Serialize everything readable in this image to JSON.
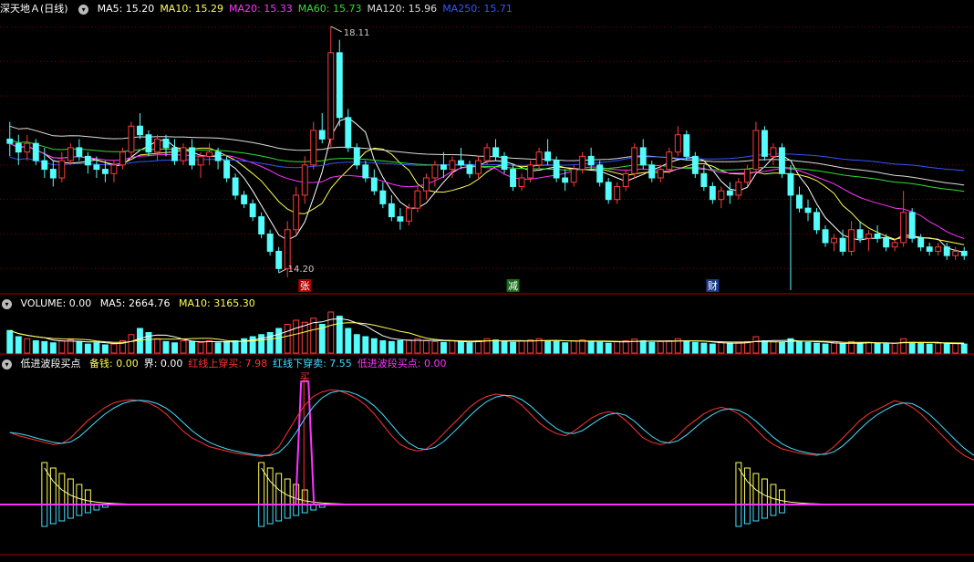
{
  "price_panel": {
    "title": "深天地Ａ(日线)",
    "indicators": [
      {
        "label": "MA5: 15.20",
        "color": "#ffffff"
      },
      {
        "label": "MA10: 15.29",
        "color": "#ffff55"
      },
      {
        "label": "MA20: 15.33",
        "color": "#ff33ff"
      },
      {
        "label": "MA60: 15.73",
        "color": "#33dd33"
      },
      {
        "label": "MA120: 15.96",
        "color": "#dddddd"
      },
      {
        "label": "MA250: 15.71",
        "color": "#3355ff"
      }
    ],
    "high_label": "18.11",
    "low_label": "14.20",
    "event_marks": [
      "张",
      "减",
      "财"
    ]
  },
  "volume_panel": {
    "title": "VOLUME: 0.00",
    "ma5": "MA5: 2664.76",
    "ma10": "MA10: 3165.30"
  },
  "indicator_panel": {
    "title": "低进波段买点",
    "fields": [
      {
        "label": "备钱: 0.00",
        "color": "#ffff55"
      },
      {
        "label": "界: 0.00",
        "color": "#ffffff"
      },
      {
        "label": "红线上穿买: 7.98",
        "color": "#ff3333"
      },
      {
        "label": "红线下穿卖: 7.55",
        "color": "#44ddff"
      },
      {
        "label": "低进波段买点: 0.00",
        "color": "#ff33ff"
      }
    ],
    "buy_signal_label": "买"
  },
  "colors": {
    "up": "#ff3c3c",
    "down": "#54fcfc",
    "grid": "#7a0000",
    "ma250": "#2b3bff"
  },
  "chart_data": [
    {
      "type": "candlestick",
      "series": "daily OHLC",
      "ohlc": [
        [
          15.5,
          15.9,
          15.1,
          15.4
        ],
        [
          15.4,
          15.6,
          14.9,
          15.2
        ],
        [
          15.2,
          15.6,
          15.0,
          15.4
        ],
        [
          15.4,
          15.5,
          14.9,
          15.0
        ],
        [
          15.0,
          15.3,
          14.6,
          14.8
        ],
        [
          14.8,
          15.0,
          14.4,
          14.6
        ],
        [
          14.6,
          15.2,
          14.5,
          15.0
        ],
        [
          15.0,
          15.4,
          14.9,
          15.3
        ],
        [
          15.3,
          15.5,
          15.0,
          15.1
        ],
        [
          15.1,
          15.2,
          14.7,
          14.9
        ],
        [
          14.9,
          15.1,
          14.6,
          14.8
        ],
        [
          14.8,
          15.0,
          14.5,
          14.7
        ],
        [
          14.7,
          15.0,
          14.5,
          14.9
        ],
        [
          14.9,
          15.3,
          14.8,
          15.2
        ],
        [
          15.2,
          15.9,
          15.1,
          15.8
        ],
        [
          15.8,
          16.1,
          15.5,
          15.6
        ],
        [
          15.6,
          15.7,
          15.1,
          15.2
        ],
        [
          15.2,
          15.6,
          15.0,
          15.5
        ],
        [
          15.5,
          15.6,
          15.1,
          15.3
        ],
        [
          15.3,
          15.5,
          14.9,
          15.0
        ],
        [
          15.0,
          15.4,
          14.9,
          15.3
        ],
        [
          15.3,
          15.5,
          14.8,
          14.9
        ],
        [
          14.9,
          15.2,
          14.6,
          15.1
        ],
        [
          15.1,
          15.4,
          14.9,
          15.2
        ],
        [
          15.2,
          15.3,
          14.8,
          15.0
        ],
        [
          15.0,
          15.1,
          14.5,
          14.6
        ],
        [
          14.6,
          14.7,
          14.1,
          14.2
        ],
        [
          14.2,
          14.3,
          13.9,
          14.0
        ],
        [
          14.0,
          14.1,
          13.6,
          13.7
        ],
        [
          13.7,
          13.8,
          13.2,
          13.3
        ],
        [
          13.3,
          13.4,
          12.8,
          12.9
        ],
        [
          12.9,
          13.0,
          12.4,
          12.5
        ],
        [
          12.5,
          13.6,
          12.3,
          13.4
        ],
        [
          13.4,
          14.4,
          13.3,
          14.2
        ],
        [
          14.2,
          15.1,
          14.0,
          14.9
        ],
        [
          14.9,
          15.9,
          14.8,
          15.7
        ],
        [
          15.7,
          16.1,
          15.4,
          15.5
        ],
        [
          15.5,
          18.11,
          15.3,
          17.5
        ],
        [
          17.5,
          17.8,
          15.8,
          16.0
        ],
        [
          16.0,
          16.2,
          15.2,
          15.3
        ],
        [
          15.3,
          15.4,
          14.8,
          14.9
        ],
        [
          14.9,
          15.0,
          14.5,
          14.6
        ],
        [
          14.6,
          14.8,
          14.2,
          14.3
        ],
        [
          14.3,
          14.5,
          13.9,
          14.0
        ],
        [
          14.0,
          14.2,
          13.6,
          13.7
        ],
        [
          13.7,
          13.9,
          13.4,
          13.6
        ],
        [
          13.6,
          14.0,
          13.5,
          13.9
        ],
        [
          13.9,
          14.4,
          13.8,
          14.3
        ],
        [
          14.3,
          14.7,
          14.1,
          14.6
        ],
        [
          14.6,
          15.0,
          14.4,
          14.9
        ],
        [
          14.9,
          15.2,
          14.6,
          14.8
        ],
        [
          14.8,
          15.1,
          14.6,
          15.0
        ],
        [
          15.0,
          15.3,
          14.8,
          14.9
        ],
        [
          14.9,
          15.0,
          14.6,
          14.7
        ],
        [
          14.7,
          15.1,
          14.6,
          15.0
        ],
        [
          15.0,
          15.4,
          14.9,
          15.3
        ],
        [
          15.3,
          15.5,
          15.0,
          15.1
        ],
        [
          15.1,
          15.2,
          14.7,
          14.8
        ],
        [
          14.8,
          14.9,
          14.3,
          14.4
        ],
        [
          14.4,
          14.7,
          14.3,
          14.6
        ],
        [
          14.6,
          15.0,
          14.5,
          14.9
        ],
        [
          14.9,
          15.3,
          14.8,
          15.2
        ],
        [
          15.2,
          15.5,
          14.9,
          15.0
        ],
        [
          15.0,
          15.1,
          14.5,
          14.6
        ],
        [
          14.6,
          14.8,
          14.3,
          14.5
        ],
        [
          14.5,
          14.9,
          14.4,
          14.8
        ],
        [
          14.8,
          15.2,
          14.7,
          15.1
        ],
        [
          15.1,
          15.3,
          14.8,
          14.9
        ],
        [
          14.9,
          15.0,
          14.4,
          14.5
        ],
        [
          14.5,
          14.6,
          14.0,
          14.1
        ],
        [
          14.1,
          14.5,
          14.0,
          14.4
        ],
        [
          14.4,
          14.8,
          14.3,
          14.7
        ],
        [
          14.7,
          15.4,
          14.6,
          15.3
        ],
        [
          15.3,
          15.5,
          14.8,
          14.9
        ],
        [
          14.9,
          15.0,
          14.5,
          14.6
        ],
        [
          14.6,
          14.9,
          14.5,
          14.8
        ],
        [
          14.8,
          15.3,
          14.7,
          15.2
        ],
        [
          15.2,
          15.8,
          15.1,
          15.6
        ],
        [
          15.6,
          15.7,
          15.0,
          15.1
        ],
        [
          15.1,
          15.2,
          14.6,
          14.7
        ],
        [
          14.7,
          14.9,
          14.3,
          14.4
        ],
        [
          14.4,
          14.5,
          14.0,
          14.1
        ],
        [
          14.1,
          14.4,
          13.9,
          14.3
        ],
        [
          14.3,
          14.5,
          14.0,
          14.2
        ],
        [
          14.2,
          14.6,
          14.1,
          14.5
        ],
        [
          14.5,
          14.9,
          14.4,
          14.8
        ],
        [
          14.8,
          15.9,
          14.7,
          15.7
        ],
        [
          15.7,
          15.8,
          15.0,
          15.1
        ],
        [
          15.1,
          15.4,
          14.9,
          15.3
        ],
        [
          15.3,
          15.4,
          14.6,
          14.7
        ],
        [
          14.7,
          14.9,
          12.0,
          14.2
        ],
        [
          14.2,
          14.4,
          13.8,
          13.9
        ],
        [
          13.9,
          14.1,
          13.6,
          13.8
        ],
        [
          13.8,
          13.9,
          13.3,
          13.4
        ],
        [
          13.4,
          13.5,
          13.0,
          13.1
        ],
        [
          13.1,
          13.3,
          12.9,
          13.2
        ],
        [
          13.2,
          13.4,
          12.8,
          12.9
        ],
        [
          12.9,
          13.6,
          12.8,
          13.4
        ],
        [
          13.4,
          13.6,
          13.1,
          13.2
        ],
        [
          13.2,
          13.4,
          12.9,
          13.3
        ],
        [
          13.3,
          13.5,
          13.1,
          13.2
        ],
        [
          13.2,
          13.3,
          12.9,
          13.0
        ],
        [
          13.0,
          13.2,
          12.9,
          13.1
        ],
        [
          13.1,
          14.3,
          13.0,
          13.8
        ],
        [
          13.8,
          13.9,
          13.1,
          13.2
        ],
        [
          13.2,
          13.3,
          12.9,
          13.0
        ],
        [
          13.0,
          13.1,
          12.8,
          12.9
        ],
        [
          12.9,
          13.1,
          12.8,
          13.0
        ],
        [
          13.0,
          13.1,
          12.7,
          12.8
        ],
        [
          12.8,
          13.0,
          12.7,
          12.9
        ],
        [
          12.9,
          13.0,
          12.7,
          12.8
        ]
      ],
      "price_range": [
        12.0,
        18.3
      ],
      "moving_averages": [
        "MA5",
        "MA10",
        "MA20",
        "MA60",
        "MA120",
        "MA250"
      ]
    },
    {
      "type": "bar",
      "series": "volume",
      "values": [
        55,
        40,
        35,
        30,
        28,
        25,
        30,
        32,
        28,
        22,
        25,
        20,
        22,
        30,
        45,
        60,
        50,
        35,
        28,
        25,
        30,
        28,
        26,
        30,
        25,
        28,
        30,
        35,
        40,
        45,
        50,
        60,
        70,
        80,
        75,
        85,
        70,
        100,
        90,
        60,
        45,
        40,
        35,
        30,
        28,
        30,
        32,
        35,
        30,
        28,
        26,
        30,
        28,
        25,
        30,
        35,
        32,
        28,
        26,
        30,
        32,
        35,
        30,
        28,
        25,
        30,
        32,
        28,
        26,
        24,
        28,
        30,
        34,
        30,
        26,
        28,
        30,
        35,
        30,
        26,
        24,
        22,
        25,
        24,
        26,
        28,
        40,
        30,
        28,
        26,
        35,
        28,
        26,
        24,
        22,
        24,
        22,
        28,
        24,
        26,
        24,
        22,
        24,
        35,
        26,
        24,
        22,
        24,
        22,
        24,
        22
      ],
      "range": [
        0,
        100
      ]
    },
    {
      "type": "line",
      "series": [
        {
          "name": "红线上穿买",
          "color": "#ff3333"
        },
        {
          "name": "红线下穿卖",
          "color": "#44ddff"
        }
      ],
      "range": [
        0,
        100
      ],
      "red": [
        55,
        52,
        50,
        48,
        46,
        44,
        45,
        50,
        58,
        66,
        72,
        78,
        82,
        84,
        85,
        84,
        82,
        78,
        72,
        64,
        56,
        50,
        46,
        42,
        40,
        38,
        36,
        35,
        34,
        33,
        35,
        42,
        55,
        68,
        80,
        88,
        92,
        94,
        93,
        90,
        86,
        80,
        72,
        62,
        52,
        44,
        40,
        38,
        40,
        46,
        54,
        62,
        70,
        78,
        84,
        88,
        90,
        89,
        86,
        80,
        72,
        64,
        58,
        54,
        52,
        56,
        62,
        68,
        72,
        74,
        72,
        66,
        58,
        50,
        46,
        44,
        46,
        52,
        60,
        66,
        72,
        76,
        78,
        76,
        72,
        66,
        58,
        50,
        44,
        40,
        38,
        36,
        35,
        34,
        36,
        42,
        50,
        58,
        66,
        72,
        76,
        80,
        84,
        82,
        78,
        72,
        64,
        56,
        48,
        40,
        34,
        30,
        32,
        36,
        40
      ]
    }
  ]
}
